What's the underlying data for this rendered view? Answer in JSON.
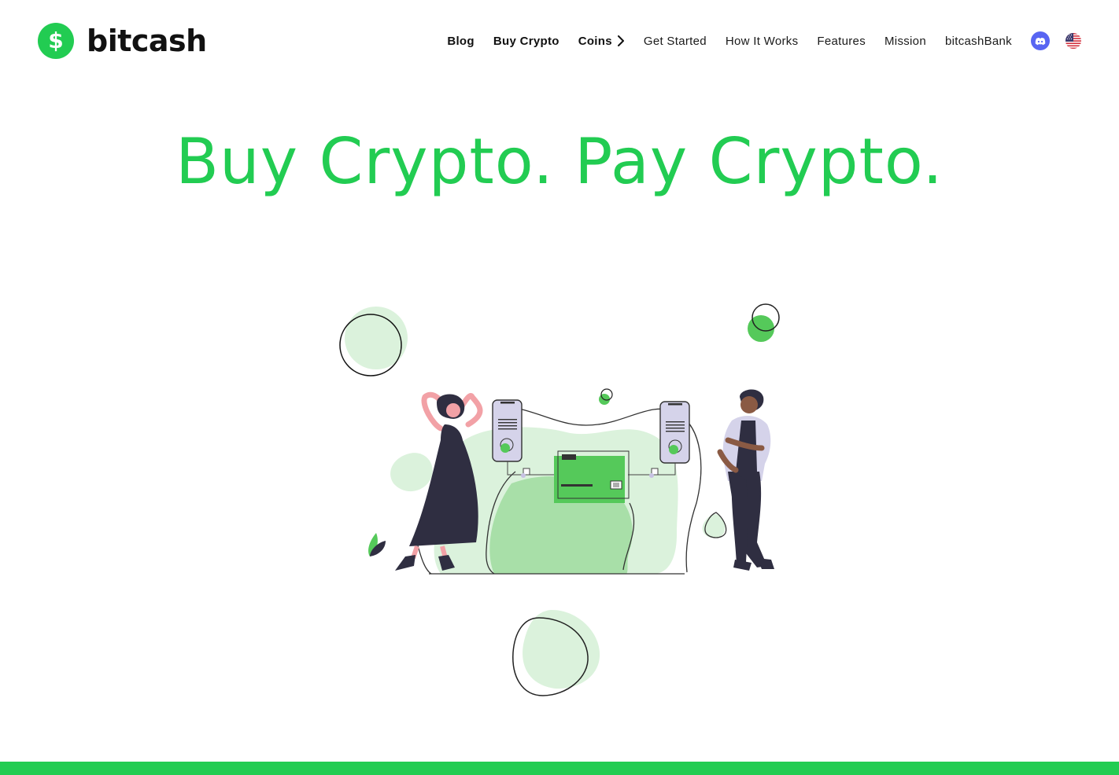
{
  "brand": {
    "logo_glyph": "$",
    "name": "bitcash",
    "accent_color": "#22cc52"
  },
  "nav": {
    "items": [
      {
        "label": "Blog"
      },
      {
        "label": "Buy Crypto"
      },
      {
        "label": "Coins"
      },
      {
        "label": "Get Started"
      },
      {
        "label": "How It Works"
      },
      {
        "label": "Features"
      },
      {
        "label": "Mission"
      },
      {
        "label": "bitcashBank"
      }
    ],
    "coins_icon": "chevron-right-icon",
    "discord_icon": "discord-icon",
    "language_icon": "us-flag-icon"
  },
  "hero": {
    "title": "Buy Crypto. Pay Crypto."
  },
  "colors": {
    "accent": "#22cc52",
    "light_green": "#dbf2dc",
    "mid_green": "#a8dfa8",
    "card_green": "#55c95a",
    "discord": "#5865f2"
  }
}
